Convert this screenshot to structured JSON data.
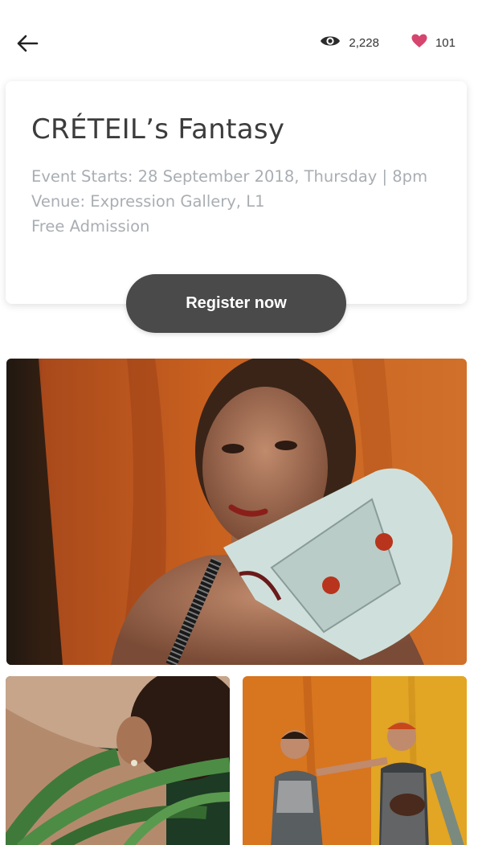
{
  "header": {
    "back_icon": "arrow-left-icon",
    "views_icon": "eye-icon",
    "views_count": "2,228",
    "likes_icon": "heart-icon",
    "likes_count": "101",
    "heart_color": "#d6456e"
  },
  "event": {
    "title": "CRÉTEIL’s  Fantasy",
    "starts": "Event Starts: 28 September 2018, Thursday | 8pm",
    "venue": "Venue: Expression Gallery, L1",
    "admission": "Free Admission"
  },
  "register": {
    "label": "Register now",
    "color": "#4a4a4a"
  },
  "gallery": {
    "main_photo": "photo: woman with white leather bag on orange backdrop",
    "left_photo": "photo: curly hair and earring among green leaves",
    "right_photo": "photo: two models on orange and yellow backdrop"
  }
}
